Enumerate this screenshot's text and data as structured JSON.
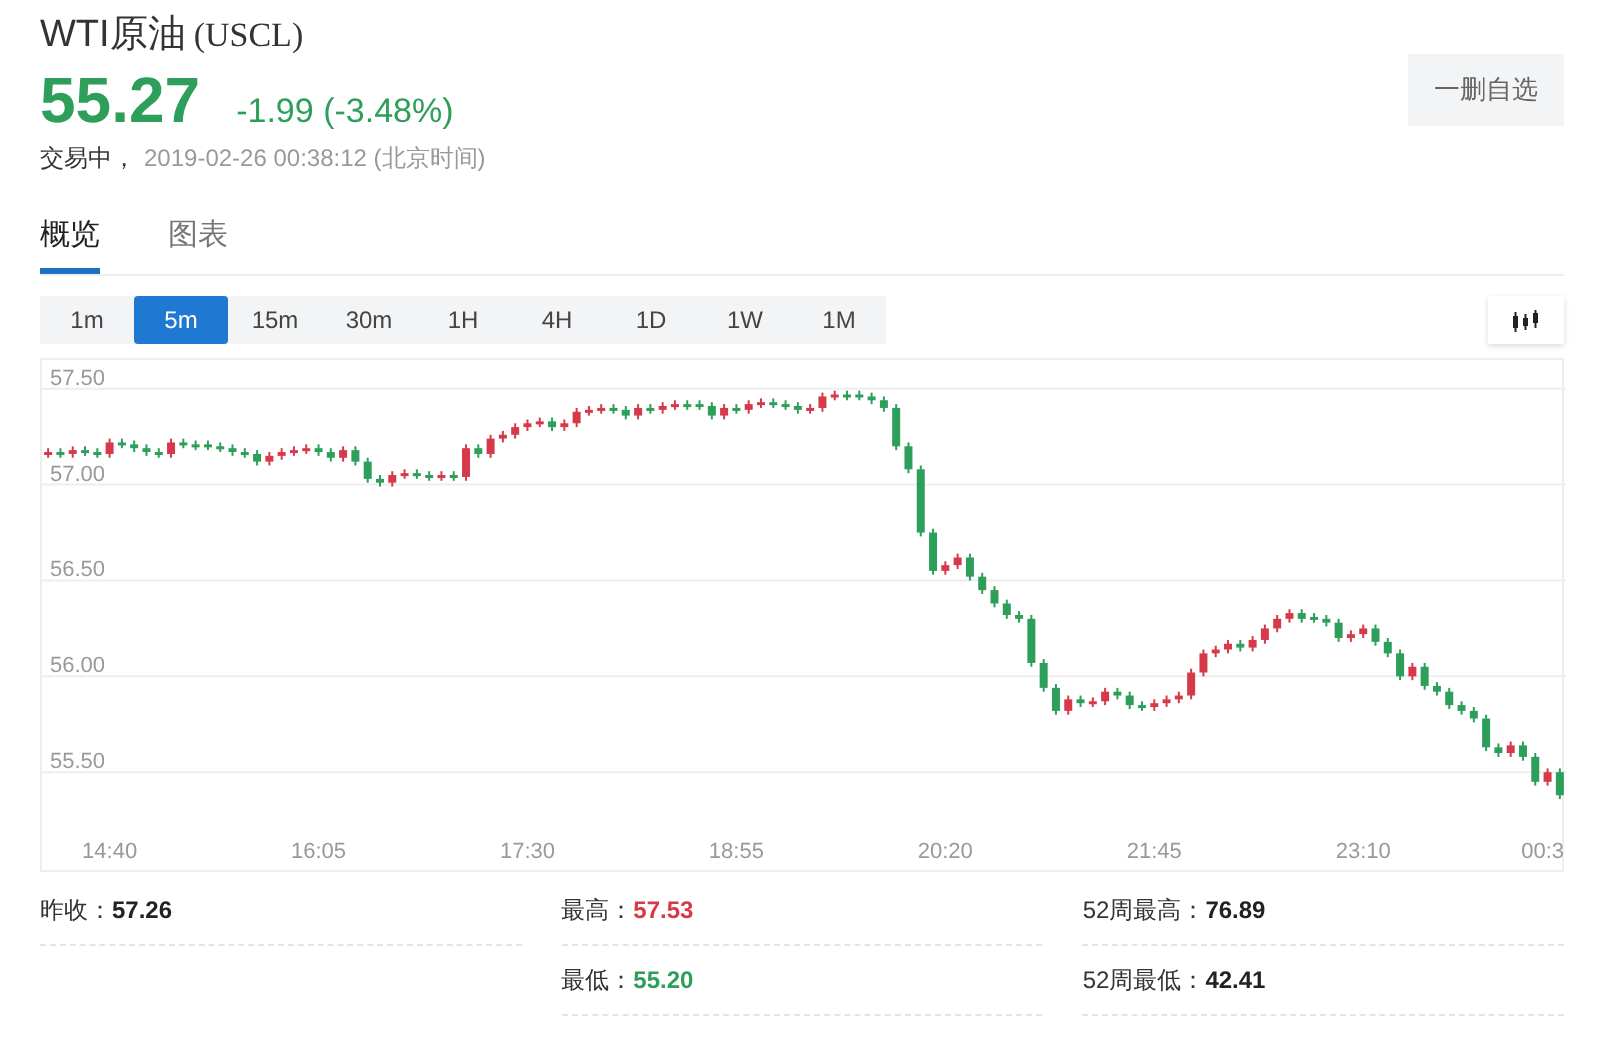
{
  "header": {
    "title": "WTI原油",
    "code": "(USCL)",
    "price": "55.27",
    "change": "-1.99",
    "change_pct": "(-3.48%)",
    "color": "#2e9e5b",
    "status": "交易中，",
    "timestamp": "2019-02-26 00:38:12",
    "timezone": "(北京时间)",
    "watch_button": "一删自选"
  },
  "tabs": [
    {
      "label": "概览",
      "selected": true
    },
    {
      "label": "图表",
      "selected": false
    }
  ],
  "periods": [
    {
      "label": "1m",
      "selected": false
    },
    {
      "label": "5m",
      "selected": true
    },
    {
      "label": "15m",
      "selected": false
    },
    {
      "label": "30m",
      "selected": false
    },
    {
      "label": "1H",
      "selected": false
    },
    {
      "label": "4H",
      "selected": false
    },
    {
      "label": "1D",
      "selected": false
    },
    {
      "label": "1W",
      "selected": false
    },
    {
      "label": "1M",
      "selected": false
    }
  ],
  "chart": {
    "chart_data": {
      "type": "candlestick",
      "grid": true,
      "ylim": [
        54.99,
        57.65
      ],
      "yticks": [
        {
          "value": 57.5,
          "label": "57.50"
        },
        {
          "value": 57,
          "label": "57.00"
        },
        {
          "value": 56.5,
          "label": "56.50"
        },
        {
          "value": 56,
          "label": "56.00"
        },
        {
          "value": 55.5,
          "label": "55.50"
        }
      ],
      "categories": [
        null,
        null,
        null,
        null,
        null,
        "14:40",
        null,
        null,
        null,
        null,
        null,
        null,
        null,
        null,
        null,
        null,
        null,
        null,
        null,
        null,
        null,
        null,
        "16:05",
        null,
        null,
        null,
        null,
        null,
        null,
        null,
        null,
        null,
        null,
        null,
        null,
        null,
        null,
        null,
        null,
        "17:30",
        null,
        null,
        null,
        null,
        null,
        null,
        null,
        null,
        null,
        null,
        null,
        null,
        null,
        null,
        null,
        null,
        "18:55",
        null,
        null,
        null,
        null,
        null,
        null,
        null,
        null,
        null,
        null,
        null,
        null,
        null,
        null,
        null,
        null,
        "20:20",
        null,
        null,
        null,
        null,
        null,
        null,
        null,
        null,
        null,
        null,
        null,
        null,
        null,
        null,
        null,
        null,
        "21:45",
        null,
        null,
        null,
        null,
        null,
        null,
        null,
        null,
        null,
        null,
        null,
        null,
        null,
        null,
        null,
        null,
        "23:10",
        null,
        null,
        null,
        null,
        null,
        null,
        null,
        null,
        null,
        null,
        null,
        null,
        null,
        null,
        "00:3",
        null
      ],
      "ohlc": [
        [
          57.16,
          57.19,
          57.14,
          57.17
        ],
        [
          57.17,
          57.19,
          57.14,
          57.16
        ],
        [
          57.16,
          57.2,
          57.14,
          57.18
        ],
        [
          57.18,
          57.2,
          57.15,
          57.17
        ],
        [
          57.17,
          57.19,
          57.14,
          57.16
        ],
        [
          57.16,
          57.24,
          57.14,
          57.22
        ],
        [
          57.22,
          57.24,
          57.19,
          57.21
        ],
        [
          57.21,
          57.23,
          57.17,
          57.19
        ],
        [
          57.19,
          57.21,
          57.15,
          57.17
        ],
        [
          57.17,
          57.19,
          57.14,
          57.16
        ],
        [
          57.16,
          57.24,
          57.14,
          57.22
        ],
        [
          57.22,
          57.24,
          57.19,
          57.21
        ],
        [
          57.21,
          57.23,
          57.18,
          57.2
        ],
        [
          57.21,
          57.23,
          57.18,
          57.2
        ],
        [
          57.2,
          57.22,
          57.17,
          57.19
        ],
        [
          57.19,
          57.21,
          57.15,
          57.17
        ],
        [
          57.17,
          57.19,
          57.14,
          57.16
        ],
        [
          57.16,
          57.18,
          57.1,
          57.12
        ],
        [
          57.12,
          57.17,
          57.1,
          57.15
        ],
        [
          57.15,
          57.19,
          57.13,
          57.17
        ],
        [
          57.17,
          57.2,
          57.15,
          57.18
        ],
        [
          57.18,
          57.21,
          57.16,
          57.19
        ],
        [
          57.19,
          57.21,
          57.15,
          57.17
        ],
        [
          57.17,
          57.19,
          57.12,
          57.14
        ],
        [
          57.14,
          57.2,
          57.12,
          57.18
        ],
        [
          57.18,
          57.2,
          57.1,
          57.12
        ],
        [
          57.12,
          57.14,
          57.01,
          57.03
        ],
        [
          57.03,
          57.05,
          56.99,
          57.01
        ],
        [
          57.01,
          57.07,
          56.99,
          57.05
        ],
        [
          57.05,
          57.08,
          57.03,
          57.06
        ],
        [
          57.06,
          57.08,
          57.03,
          57.05
        ],
        [
          57.05,
          57.07,
          57.02,
          57.04
        ],
        [
          57.04,
          57.07,
          57.02,
          57.05
        ],
        [
          57.05,
          57.07,
          57.02,
          57.04
        ],
        [
          57.04,
          57.21,
          57.02,
          57.19
        ],
        [
          57.19,
          57.21,
          57.14,
          57.16
        ],
        [
          57.16,
          57.26,
          57.14,
          57.24
        ],
        [
          57.24,
          57.28,
          57.22,
          57.26
        ],
        [
          57.26,
          57.32,
          57.24,
          57.3
        ],
        [
          57.3,
          57.34,
          57.28,
          57.32
        ],
        [
          57.32,
          57.35,
          57.3,
          57.33
        ],
        [
          57.33,
          57.35,
          57.28,
          57.3
        ],
        [
          57.3,
          57.34,
          57.28,
          57.32
        ],
        [
          57.32,
          57.4,
          57.3,
          57.38
        ],
        [
          57.38,
          57.41,
          57.36,
          57.39
        ],
        [
          57.39,
          57.42,
          57.37,
          57.4
        ],
        [
          57.4,
          57.42,
          57.37,
          57.39
        ],
        [
          57.39,
          57.41,
          57.34,
          57.36
        ],
        [
          57.36,
          57.42,
          57.34,
          57.4
        ],
        [
          57.4,
          57.42,
          57.37,
          57.39
        ],
        [
          57.39,
          57.43,
          57.37,
          57.41
        ],
        [
          57.41,
          57.44,
          57.39,
          57.42
        ],
        [
          57.42,
          57.44,
          57.39,
          57.41
        ],
        [
          57.42,
          57.44,
          57.39,
          57.41
        ],
        [
          57.41,
          57.43,
          57.34,
          57.36
        ],
        [
          57.36,
          57.42,
          57.34,
          57.4
        ],
        [
          57.4,
          57.42,
          57.37,
          57.39
        ],
        [
          57.39,
          57.44,
          57.37,
          57.42
        ],
        [
          57.42,
          57.45,
          57.4,
          57.43
        ],
        [
          57.43,
          57.45,
          57.4,
          57.42
        ],
        [
          57.42,
          57.44,
          57.39,
          57.41
        ],
        [
          57.41,
          57.43,
          57.37,
          57.39
        ],
        [
          57.39,
          57.42,
          57.37,
          57.4
        ],
        [
          57.4,
          57.48,
          57.38,
          57.46
        ],
        [
          57.46,
          57.49,
          57.44,
          57.47
        ],
        [
          57.47,
          57.49,
          57.44,
          57.46
        ],
        [
          57.47,
          57.49,
          57.44,
          57.46
        ],
        [
          57.46,
          57.48,
          57.42,
          57.44
        ],
        [
          57.44,
          57.46,
          57.38,
          57.4
        ],
        [
          57.4,
          57.42,
          57.18,
          57.2
        ],
        [
          57.2,
          57.22,
          57.06,
          57.08
        ],
        [
          57.08,
          57.1,
          56.73,
          56.75
        ],
        [
          56.75,
          56.77,
          56.53,
          56.55
        ],
        [
          56.55,
          56.6,
          56.53,
          56.58
        ],
        [
          56.58,
          56.64,
          56.56,
          56.62
        ],
        [
          56.62,
          56.64,
          56.5,
          56.52
        ],
        [
          56.52,
          56.54,
          56.43,
          56.45
        ],
        [
          56.45,
          56.47,
          56.36,
          56.38
        ],
        [
          56.38,
          56.4,
          56.3,
          56.32
        ],
        [
          56.32,
          56.34,
          56.28,
          56.3
        ],
        [
          56.3,
          56.32,
          56.05,
          56.07
        ],
        [
          56.07,
          56.09,
          55.92,
          55.94
        ],
        [
          55.94,
          55.96,
          55.8,
          55.82
        ],
        [
          55.82,
          55.9,
          55.8,
          55.88
        ],
        [
          55.88,
          55.9,
          55.84,
          55.86
        ],
        [
          55.86,
          55.89,
          55.84,
          55.87
        ],
        [
          55.87,
          55.94,
          55.85,
          55.92
        ],
        [
          55.92,
          55.94,
          55.88,
          55.9
        ],
        [
          55.9,
          55.92,
          55.83,
          55.85
        ],
        [
          55.85,
          55.87,
          55.82,
          55.84
        ],
        [
          55.84,
          55.88,
          55.82,
          55.86
        ],
        [
          55.86,
          55.9,
          55.84,
          55.88
        ],
        [
          55.88,
          55.92,
          55.86,
          55.9
        ],
        [
          55.9,
          56.04,
          55.88,
          56.02
        ],
        [
          56.02,
          56.14,
          56,
          56.12
        ],
        [
          56.12,
          56.16,
          56.1,
          56.14
        ],
        [
          56.14,
          56.19,
          56.12,
          56.17
        ],
        [
          56.17,
          56.19,
          56.13,
          56.15
        ],
        [
          56.15,
          56.21,
          56.13,
          56.19
        ],
        [
          56.19,
          56.27,
          56.17,
          56.25
        ],
        [
          56.25,
          56.32,
          56.23,
          56.3
        ],
        [
          56.3,
          56.35,
          56.28,
          56.33
        ],
        [
          56.33,
          56.35,
          56.28,
          56.3
        ],
        [
          56.31,
          56.33,
          56.28,
          56.3
        ],
        [
          56.3,
          56.32,
          56.26,
          56.28
        ],
        [
          56.28,
          56.3,
          56.18,
          56.2
        ],
        [
          56.2,
          56.24,
          56.18,
          56.22
        ],
        [
          56.22,
          56.27,
          56.2,
          56.25
        ],
        [
          56.25,
          56.27,
          56.16,
          56.18
        ],
        [
          56.18,
          56.2,
          56.1,
          56.12
        ],
        [
          56.12,
          56.14,
          55.98,
          56
        ],
        [
          56,
          56.07,
          55.98,
          56.05
        ],
        [
          56.05,
          56.07,
          55.93,
          55.95
        ],
        [
          55.95,
          55.97,
          55.9,
          55.92
        ],
        [
          55.92,
          55.94,
          55.83,
          55.85
        ],
        [
          55.85,
          55.87,
          55.8,
          55.82
        ],
        [
          55.82,
          55.84,
          55.76,
          55.78
        ],
        [
          55.78,
          55.8,
          55.61,
          55.63
        ],
        [
          55.63,
          55.65,
          55.58,
          55.6
        ],
        [
          55.6,
          55.66,
          55.58,
          55.64
        ],
        [
          55.64,
          55.66,
          55.56,
          55.58
        ],
        [
          55.58,
          55.6,
          55.43,
          55.45
        ],
        [
          55.45,
          55.52,
          55.43,
          55.5
        ],
        [
          55.5,
          55.52,
          55.36,
          55.38
        ]
      ]
    }
  },
  "stats": [
    [
      {
        "label": "昨收：",
        "value": "57.26",
        "color": "#222222"
      }
    ],
    [
      {
        "label": "最高：",
        "value": "57.53",
        "color": "#d63a4a"
      },
      {
        "label": "最低：",
        "value": "55.20",
        "color": "#2e9e5b"
      }
    ],
    [
      {
        "label": "52周最高：",
        "value": "76.89",
        "color": "#222222"
      },
      {
        "label": "52周最低：",
        "value": "42.41",
        "color": "#222222"
      }
    ]
  ]
}
